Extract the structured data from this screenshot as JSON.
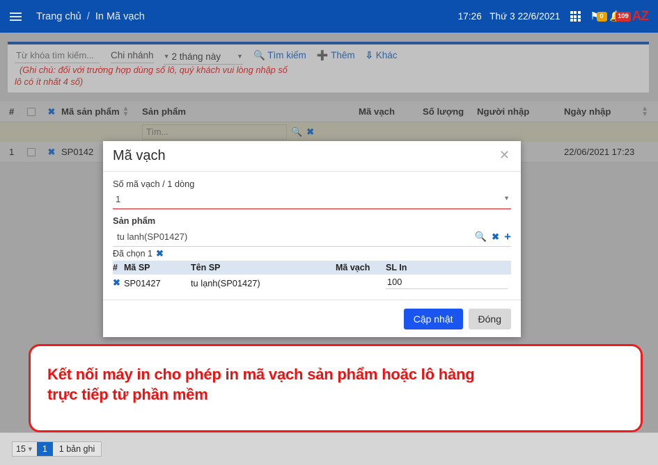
{
  "topbar": {
    "menu_icon": "hamburger-icon",
    "breadcrumb_home": "Trang chủ",
    "breadcrumb_sep": "/",
    "breadcrumb_current": "In Mã vạch",
    "time": "17:26",
    "date": "Thứ 3 22/6/2021",
    "grid_icon": "apps-grid-icon",
    "flag_icon": "flag-icon",
    "flag_badge": "0",
    "bell_icon": "bell-icon",
    "bell_badge": "109",
    "logo": "AZ",
    "bg_color": "#0b50af"
  },
  "filter": {
    "keyword_placeholder": "Từ khóa tìm kiếm...",
    "keyword_value": "",
    "branch_label": "Chi nhánh",
    "period_label": "2 tháng này",
    "search_label": "Tìm kiếm",
    "add_label": "Thêm",
    "other_label": "Khác",
    "note_line1": "(Ghi chú: đối với trường hợp dùng số lô, quý khách vui lòng nhập số",
    "note_line2": "lô có ít nhất 4 số)",
    "note_color": "#d8261f",
    "accent_color": "#1559ac"
  },
  "table": {
    "headers": {
      "num": "#",
      "product_code": "Mã sản phẩm",
      "product": "Sản phẩm",
      "barcode": "Mã vạch",
      "quantity": "Số lượng",
      "entered_by": "Người nhập",
      "entry_date": "Ngày nhập"
    },
    "filter_row": {
      "search_placeholder": "Tìm...",
      "search_value": "",
      "search_icon": "magnifier-icon",
      "clear_icon": "clear-x-icon"
    },
    "rows": [
      {
        "num": "1",
        "product_code": "SP0142",
        "product": "",
        "barcode": "",
        "quantity": "",
        "entered_by": "",
        "entry_date": "22/06/2021 17:23"
      }
    ]
  },
  "modal": {
    "title": "Mã vạch",
    "close_icon": "close-x-icon",
    "field_count_label": "Số mã vạch / 1 dòng",
    "field_count_value": "1",
    "field_product_label": "Sản phẩm",
    "field_product_value": "tu lanh(SP01427)",
    "product_search_icon": "magnifier-icon",
    "product_clear_icon": "clear-x-icon",
    "product_add_icon": "plus-icon",
    "chosen_label": "Đã chọn 1",
    "chosen_clear_icon": "clear-x-icon",
    "mini_headers": {
      "hash": "#",
      "code": "Mã SP",
      "name": "Tên SP",
      "barcode": "Mã vạch",
      "print_qty": "SL In"
    },
    "mini_rows": [
      {
        "remove_icon": "remove-x-icon",
        "code": "SP01427",
        "name": "tu lạnh(SP01427)",
        "barcode": "",
        "print_qty": "100"
      }
    ],
    "btn_update": "Cập nhật",
    "btn_close": "Đóng",
    "btn_update_color": "#1a55f0"
  },
  "annotation": {
    "line1": "Kết nối máy in cho phép in mã vạch sản phẩm hoặc lô hàng",
    "line2": "trực tiếp từ phần mềm",
    "border_color": "#ee1c1c",
    "text_color": "#f01010"
  },
  "footer": {
    "page_size": "15",
    "current_page": "1",
    "record_count": "1 bản ghi"
  }
}
